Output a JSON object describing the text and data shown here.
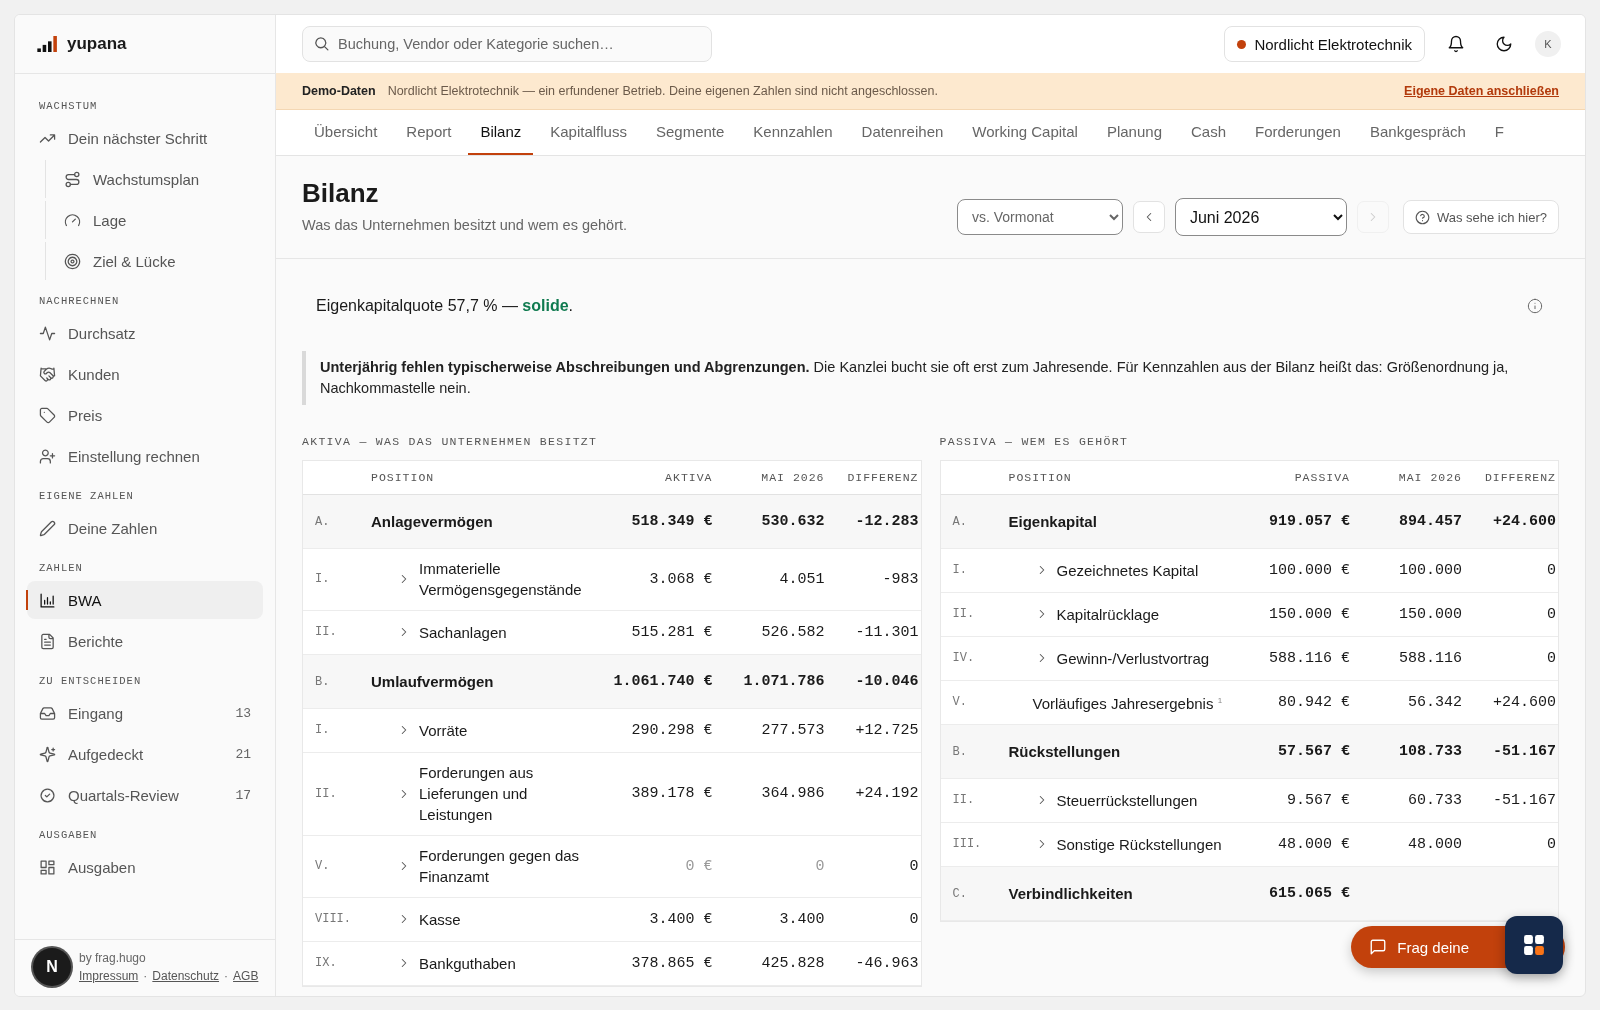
{
  "brand": {
    "name": "yupana"
  },
  "sidebar": {
    "sections": [
      {
        "title": "WACHSTUM",
        "items": [
          {
            "label": "Dein nächster Schritt",
            "selected": false,
            "children": [
              {
                "label": "Wachstumsplan",
                "selected": false
              },
              {
                "label": "Lage",
                "selected": false
              },
              {
                "label": "Ziel & Lücke",
                "selected": false
              }
            ]
          }
        ]
      },
      {
        "title": "NACHRECHNEN",
        "items": [
          {
            "label": "Durchsatz",
            "selected": false
          },
          {
            "label": "Kunden",
            "selected": false
          },
          {
            "label": "Preis",
            "selected": false
          },
          {
            "label": "Einstellung rechnen",
            "selected": false
          }
        ]
      },
      {
        "title": "EIGENE ZAHLEN",
        "items": [
          {
            "label": "Deine Zahlen",
            "selected": false
          }
        ]
      },
      {
        "title": "ZAHLEN",
        "items": [
          {
            "label": "BWA",
            "selected": true
          },
          {
            "label": "Berichte",
            "selected": false
          }
        ]
      },
      {
        "title": "ZU ENTSCHEIDEN",
        "items": [
          {
            "label": "Eingang",
            "selected": false,
            "count": "13"
          },
          {
            "label": "Aufgedeckt",
            "selected": false,
            "count": "21"
          },
          {
            "label": "Quartals-Review",
            "selected": false,
            "count": "17"
          }
        ]
      },
      {
        "title": "AUSGABEN",
        "items": [
          {
            "label": "Ausgaben",
            "selected": false
          }
        ]
      }
    ],
    "footer": {
      "credit": "by frag.hugo",
      "links": [
        "Impressum",
        "Datenschutz",
        "AGB"
      ],
      "separator": "·",
      "badge": "N"
    }
  },
  "search": {
    "placeholder": "Buchung, Vendor oder Kategorie suchen…"
  },
  "company": {
    "name": "Nordlicht Elektrotechnik"
  },
  "avatar": {
    "initial": "K"
  },
  "banner": {
    "label": "Demo-Daten",
    "text": "Nordlicht Elektrotechnik — ein erfundener Betrieb. Deine eigenen Zahlen sind nicht angeschlossen.",
    "link": "Eigene Daten anschließen"
  },
  "tabs": [
    {
      "label": "Übersicht",
      "selected": false
    },
    {
      "label": "Report",
      "selected": false
    },
    {
      "label": "Bilanz",
      "selected": true
    },
    {
      "label": "Kapitalfluss",
      "selected": false
    },
    {
      "label": "Segmente",
      "selected": false
    },
    {
      "label": "Kennzahlen",
      "selected": false
    },
    {
      "label": "Datenreihen",
      "selected": false
    },
    {
      "label": "Working Capital",
      "selected": false
    },
    {
      "label": "Planung",
      "selected": false
    },
    {
      "label": "Cash",
      "selected": false
    },
    {
      "label": "Forderungen",
      "selected": false
    },
    {
      "label": "Bankgespräch",
      "selected": false
    },
    {
      "label": "F",
      "selected": false
    }
  ],
  "page": {
    "title": "Bilanz",
    "subtitle": "Was das Unternehmen besitzt und wem es gehört.",
    "comparison": {
      "value": "vs. Vormonat"
    },
    "period": {
      "value": "Juni 2026",
      "prev_disabled": false,
      "next_disabled": true
    },
    "help": "Was sehe ich hier?"
  },
  "kpi": {
    "text": "Eigenkapitalquote 57,7 % — ",
    "rating": "solide",
    "good": true,
    "end": "."
  },
  "note": "**Unterjährig fehlen typischerweise Abschreibungen und Abgrenzungen.** Die Kanzlei bucht sie oft erst zum Jahresende. Für Kennzahlen aus der Bilanz heißt das: Größenordnung ja, Nachkommastelle nein.",
  "tables": [
    {
      "title": "AKTIVA — WAS DAS UNTERNEHMEN BESITZT",
      "columns": [
        "POSITION",
        "AKTIVA",
        "MAI 2026",
        "DIFFERENZ"
      ],
      "rows": [
        {
          "kind": "group",
          "num": "A.",
          "label": "Anlagevermögen",
          "value": "518.349 €",
          "prev": "530.632",
          "diff": "-12.283",
          "muted": false
        },
        {
          "kind": "item",
          "num": "I.",
          "label": "Immaterielle Vermögensgegenstände",
          "value": "3.068 €",
          "prev": "4.051",
          "diff": "-983",
          "muted": false
        },
        {
          "kind": "item",
          "num": "II.",
          "label": "Sachanlagen",
          "value": "515.281 €",
          "prev": "526.582",
          "diff": "-11.301",
          "muted": false
        },
        {
          "kind": "group",
          "num": "B.",
          "label": "Umlaufvermögen",
          "value": "1.061.740 €",
          "prev": "1.071.786",
          "diff": "-10.046",
          "muted": false
        },
        {
          "kind": "item",
          "num": "I.",
          "label": "Vorräte",
          "value": "290.298 €",
          "prev": "277.573",
          "diff": "+12.725",
          "muted": false
        },
        {
          "kind": "item",
          "num": "II.",
          "label": "Forderungen aus Lieferungen und Leistungen",
          "value": "389.178 €",
          "prev": "364.986",
          "diff": "+24.192",
          "muted": false
        },
        {
          "kind": "item",
          "num": "V.",
          "label": "Forderungen gegen das Finanzamt",
          "value": "0 €",
          "prev": "0",
          "diff": "0",
          "muted": true
        },
        {
          "kind": "item",
          "num": "VIII.",
          "label": "Kasse",
          "value": "3.400 €",
          "prev": "3.400",
          "diff": "0",
          "muted": false
        },
        {
          "kind": "item",
          "num": "IX.",
          "label": "Bankguthaben",
          "value": "378.865 €",
          "prev": "425.828",
          "diff": "-46.963",
          "muted": false
        }
      ]
    },
    {
      "title": "PASSIVA — WEM ES GEHÖRT",
      "columns": [
        "POSITION",
        "PASSIVA",
        "MAI 2026",
        "DIFFERENZ"
      ],
      "rows": [
        {
          "kind": "group",
          "num": "A.",
          "label": "Eigenkapital",
          "value": "919.057 €",
          "prev": "894.457",
          "diff": "+24.600",
          "muted": false
        },
        {
          "kind": "item",
          "num": "I.",
          "label": "Gezeichnetes Kapital",
          "value": "100.000 €",
          "prev": "100.000",
          "diff": "0",
          "muted": false
        },
        {
          "kind": "item",
          "num": "II.",
          "label": "Kapitalrücklage",
          "value": "150.000 €",
          "prev": "150.000",
          "diff": "0",
          "muted": false
        },
        {
          "kind": "item",
          "num": "IV.",
          "label": "Gewinn-/Verlustvortrag",
          "value": "588.116 €",
          "prev": "588.116",
          "diff": "0",
          "muted": false
        },
        {
          "kind": "plain",
          "num": "V.",
          "label": "Vorläufiges Jahresergebnis $^{1}$",
          "value": "80.942 €",
          "prev": "56.342",
          "diff": "+24.600",
          "muted": false
        },
        {
          "kind": "group",
          "num": "B.",
          "label": "Rückstellungen",
          "value": "57.567 €",
          "prev": "108.733",
          "diff": "-51.167",
          "muted": false
        },
        {
          "kind": "item",
          "num": "II.",
          "label": "Steuerrückstellungen",
          "value": "9.567 €",
          "prev": "60.733",
          "diff": "-51.167",
          "muted": false
        },
        {
          "kind": "item",
          "num": "III.",
          "label": "Sonstige Rückstellungen",
          "value": "48.000 €",
          "prev": "48.000",
          "diff": "0",
          "muted": false
        },
        {
          "kind": "group",
          "num": "C.",
          "label": "Verbindlichkeiten",
          "value": "615.065 €",
          "muted": false
        }
      ]
    }
  ],
  "chat": {
    "label": "Frag deine"
  }
}
